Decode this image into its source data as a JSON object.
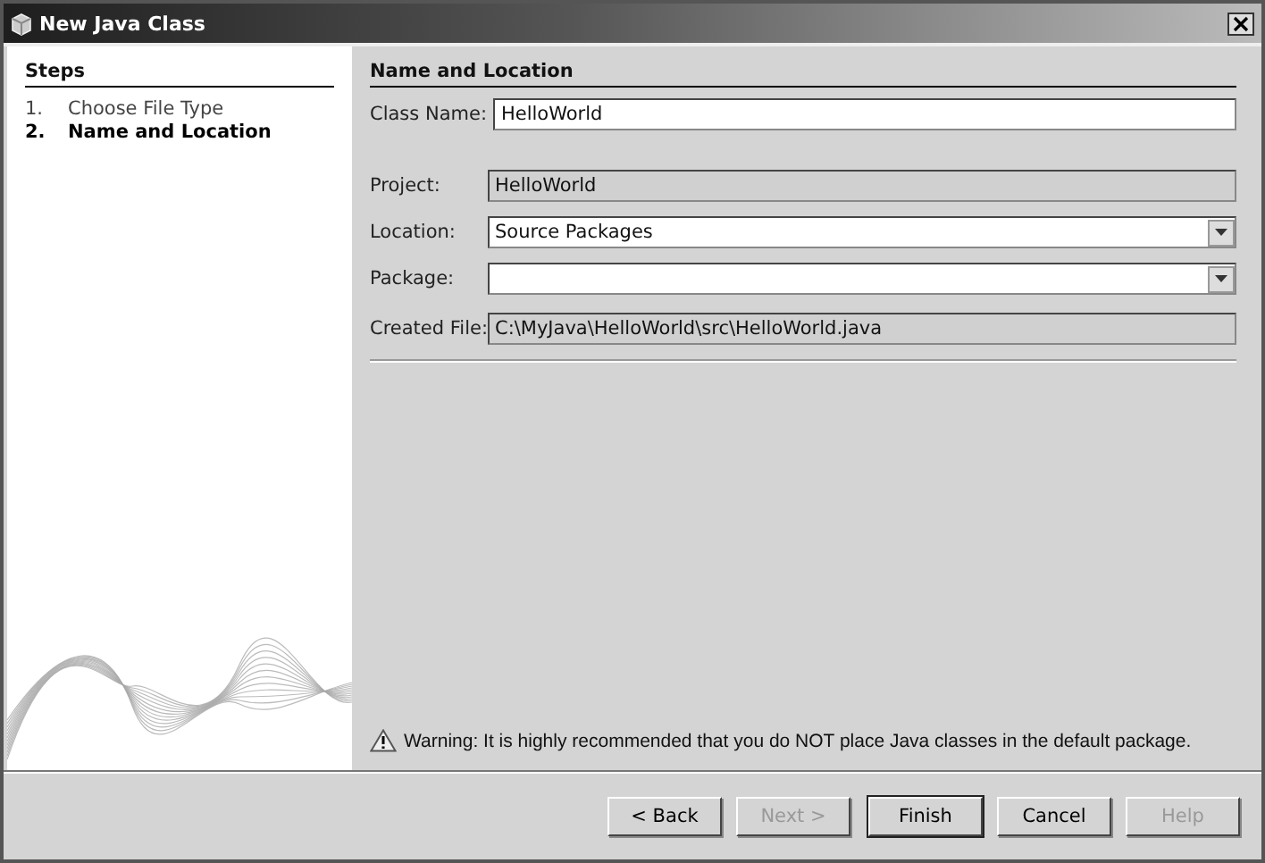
{
  "window": {
    "title": "New Java Class"
  },
  "steps": {
    "title": "Steps",
    "items": [
      {
        "number": "1.",
        "label": "Choose File Type",
        "selected": false
      },
      {
        "number": "2.",
        "label": "Name and Location",
        "selected": true
      }
    ]
  },
  "panel": {
    "title": "Name and Location",
    "fields": [
      {
        "kind": "text",
        "label": "Class Name:",
        "value": "HelloWorld"
      },
      {
        "kind": "readonly",
        "label": "Project:",
        "value": "HelloWorld"
      },
      {
        "kind": "combo",
        "label": "Location:",
        "value": "Source Packages"
      },
      {
        "kind": "combo",
        "label": "Package:"
      },
      {
        "kind": "readonly",
        "label": "Created File:",
        "value": "C:\\MyJava\\HelloWorld\\src\\HelloWorld.java"
      }
    ],
    "warning": "Warning: It is highly recommended that you do NOT place Java classes in the default package."
  },
  "buttons": [
    {
      "label": "< Back",
      "disabled": false,
      "default": false
    },
    {
      "label": "Next >",
      "disabled": true,
      "default": false
    },
    {
      "label": "Finish",
      "disabled": false,
      "default": true
    },
    {
      "label": "Cancel",
      "disabled": false,
      "default": false
    },
    {
      "label": "Help",
      "disabled": true,
      "default": false
    }
  ]
}
